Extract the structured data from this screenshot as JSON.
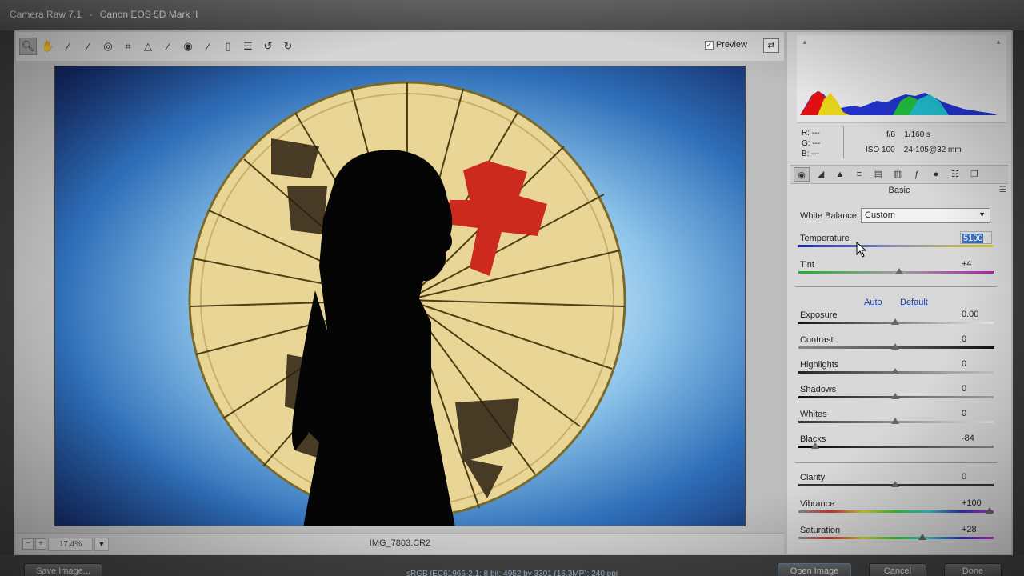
{
  "window": {
    "app_title": "Camera Raw 7.1",
    "separator": "-",
    "camera_model": "Canon EOS 5D Mark II"
  },
  "toolbar": {
    "tools": [
      "zoom-icon",
      "hand-icon",
      "white-balance-icon",
      "color-sampler-icon",
      "target-adjust-icon",
      "crop-icon",
      "straighten-icon",
      "spot-removal-icon",
      "red-eye-icon",
      "adjustment-brush-icon",
      "graduated-filter-icon",
      "preferences-icon",
      "rotate-ccw-icon",
      "rotate-cw-icon"
    ],
    "preview_label": "Preview",
    "preview_checked": "✓"
  },
  "canvas": {
    "zoom_value": "17.4%",
    "filename": "IMG_7803.CR2"
  },
  "panel": {
    "rgb": {
      "r": "R:  ---",
      "g": "G:  ---",
      "b": "B:  ---"
    },
    "exif": {
      "aperture_shutter": "f/8    1/160 s",
      "iso_lens": "ISO 100    24-105@32 mm"
    },
    "section_title": "Basic",
    "white_balance": {
      "label": "White Balance:",
      "value": "Custom"
    },
    "temperature": {
      "label": "Temperature",
      "value": "5100"
    },
    "tint": {
      "label": "Tint",
      "value": "+4"
    },
    "auto_label": "Auto",
    "default_label": "Default",
    "exposure": {
      "label": "Exposure",
      "value": "0.00"
    },
    "contrast": {
      "label": "Contrast",
      "value": "0"
    },
    "highlights": {
      "label": "Highlights",
      "value": "0"
    },
    "shadows": {
      "label": "Shadows",
      "value": "0"
    },
    "whites": {
      "label": "Whites",
      "value": "0"
    },
    "blacks": {
      "label": "Blacks",
      "value": "-84"
    },
    "clarity": {
      "label": "Clarity",
      "value": "0"
    },
    "vibrance": {
      "label": "Vibrance",
      "value": "+100"
    },
    "saturation": {
      "label": "Saturation",
      "value": "+28"
    }
  },
  "bottom": {
    "save_label": "Save Image...",
    "workflow": "sRGB IEC61966-2.1; 8 bit; 4952 by 3301 (16.3MP); 240 ppi",
    "open_label": "Open Image",
    "cancel_label": "Cancel",
    "done_label": "Done"
  },
  "colors": {
    "accent": "#3b6fbf",
    "link": "#1c3fa8"
  }
}
